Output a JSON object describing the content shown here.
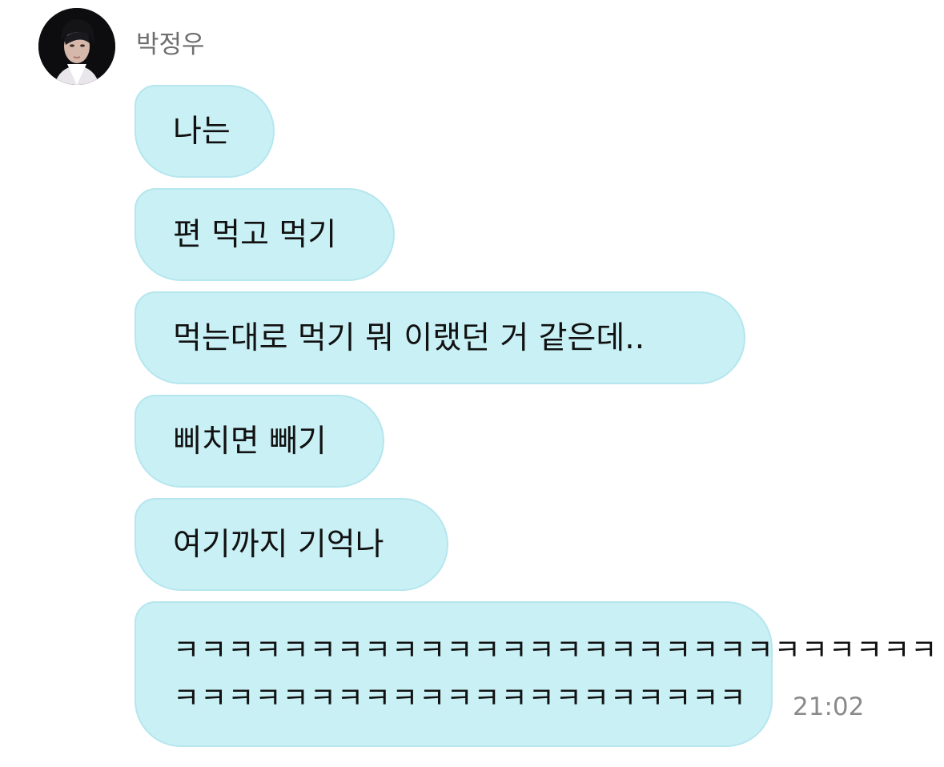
{
  "sender": {
    "name": "박정우",
    "avatar_icon": "profile-photo-avatar"
  },
  "messages": [
    {
      "text": "나는"
    },
    {
      "text": "편 먹고 먹기"
    },
    {
      "text": "먹는대로 먹기 뭐 이랬던 거 같은데.."
    },
    {
      "text": "삐치면 빼기"
    },
    {
      "text": "여기까지 기억나"
    },
    {
      "lines": [
        "ㅋㅋㅋㅋㅋㅋㅋㅋㅋㅋㅋㅋㅋㅋㅋㅋㅋㅋㅋㅋㅋㅋㅋㅋㅋㅋㅋㅋ",
        "ㅋㅋㅋㅋㅋㅋㅋㅋㅋㅋㅋㅋㅋㅋㅋㅋㅋㅋㅋㅋㅋ"
      ]
    }
  ],
  "last_message_time": "21:02",
  "colors": {
    "bubble_fill": "#c8f0f5",
    "bubble_border": "#b6e6ee",
    "message_text": "#111111",
    "name_text": "#6e6e6e",
    "time_text": "#8a8a8a"
  }
}
